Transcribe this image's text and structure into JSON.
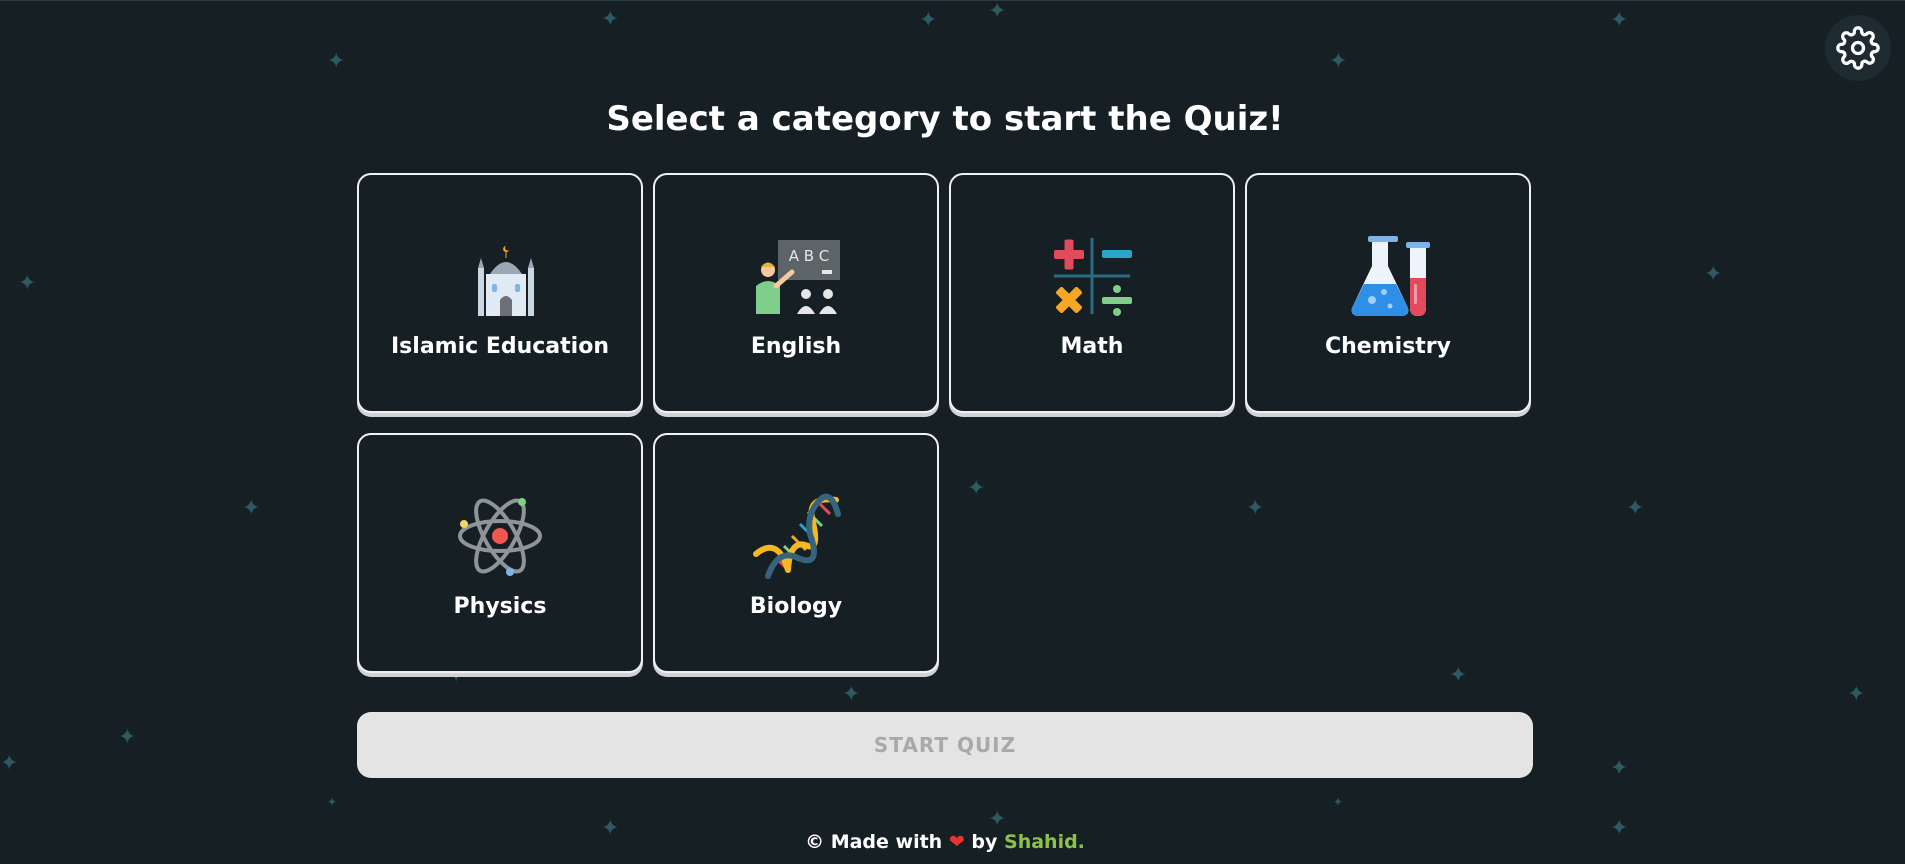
{
  "page": {
    "title": "Select a category to start the Quiz!",
    "settings_icon": "gear-icon"
  },
  "categories": [
    {
      "label": "Islamic Education",
      "icon": "mosque-icon"
    },
    {
      "label": "English",
      "icon": "teacher-blackboard-icon"
    },
    {
      "label": "Math",
      "icon": "math-operators-icon"
    },
    {
      "label": "Chemistry",
      "icon": "flask-test-tube-icon"
    },
    {
      "label": "Physics",
      "icon": "atom-icon"
    },
    {
      "label": "Biology",
      "icon": "dna-icon"
    }
  ],
  "start_button": {
    "label": "START QUIZ",
    "state": "disabled"
  },
  "footer": {
    "copyright": "©",
    "made_with": "Made with",
    "heart": "❤",
    "by": "by",
    "author": "Shahid."
  },
  "colors": {
    "background": "#161f24",
    "card_border": "#f1f1f1",
    "star": "#2d5a62",
    "start_button_bg": "#e4e4e4",
    "start_button_text": "#a9a9a9",
    "author": "#8bc34a",
    "heart": "#e8352f"
  }
}
